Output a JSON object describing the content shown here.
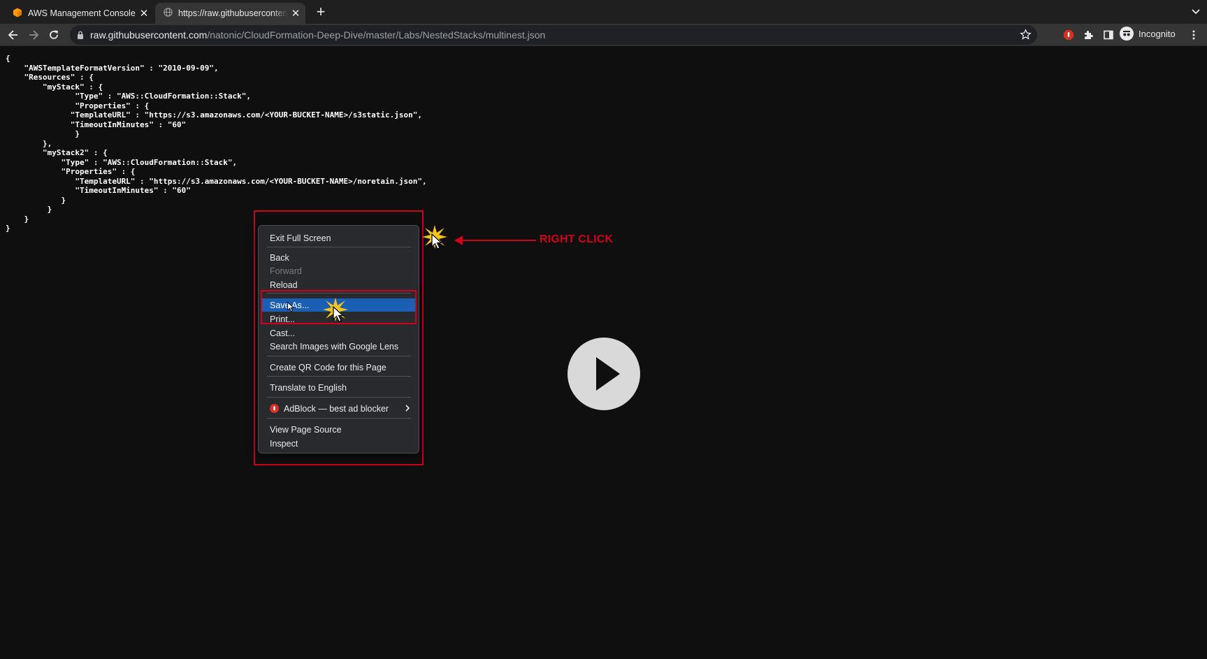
{
  "tabs": [
    {
      "title": "AWS Management Console",
      "icon": "aws-cube-icon"
    },
    {
      "title": "https://raw.githubusercontent.com/natonic/CloudFormation-Deep-Dive/master/Labs/NestedStacks/multinest.json",
      "icon": "globe-icon"
    }
  ],
  "toolbar": {
    "url_host": "raw.githubusercontent.com",
    "url_path": "/natonic/CloudFormation-Deep-Dive/master/Labs/NestedStacks/multinest.json",
    "profile_label": "Incognito"
  },
  "page": {
    "json_text": "{\n    \"AWSTemplateFormatVersion\" : \"2010-09-09\",\n    \"Resources\" : {\n        \"myStack\" : {\n               \"Type\" : \"AWS::CloudFormation::Stack\",\n               \"Properties\" : {\n              \"TemplateURL\" : \"https://s3.amazonaws.com/<YOUR-BUCKET-NAME>/s3static.json\",\n              \"TimeoutInMinutes\" : \"60\"\n               }\n        },\n        \"myStack2\" : {\n            \"Type\" : \"AWS::CloudFormation::Stack\",\n            \"Properties\" : {\n               \"TemplateURL\" : \"https://s3.amazonaws.com/<YOUR-BUCKET-NAME>/noretain.json\",\n               \"TimeoutInMinutes\" : \"60\"\n            }\n         }\n    }\n}"
  },
  "context_menu": {
    "exit_full_screen": "Exit Full Screen",
    "back": "Back",
    "forward": "Forward",
    "reload": "Reload",
    "save_as": "Save As...",
    "print": "Print...",
    "cast": "Cast...",
    "search_images": "Search Images with Google Lens",
    "qr_code": "Create QR Code for this Page",
    "translate": "Translate to English",
    "adblock": "AdBlock — best ad blocker",
    "view_source": "View Page Source",
    "inspect": "Inspect"
  },
  "annotation": {
    "label": "RIGHT CLICK",
    "color": "#d0021b"
  },
  "colors": {
    "menu_highlight": "#1a5fb4",
    "aws_orange": "#ff9900"
  }
}
